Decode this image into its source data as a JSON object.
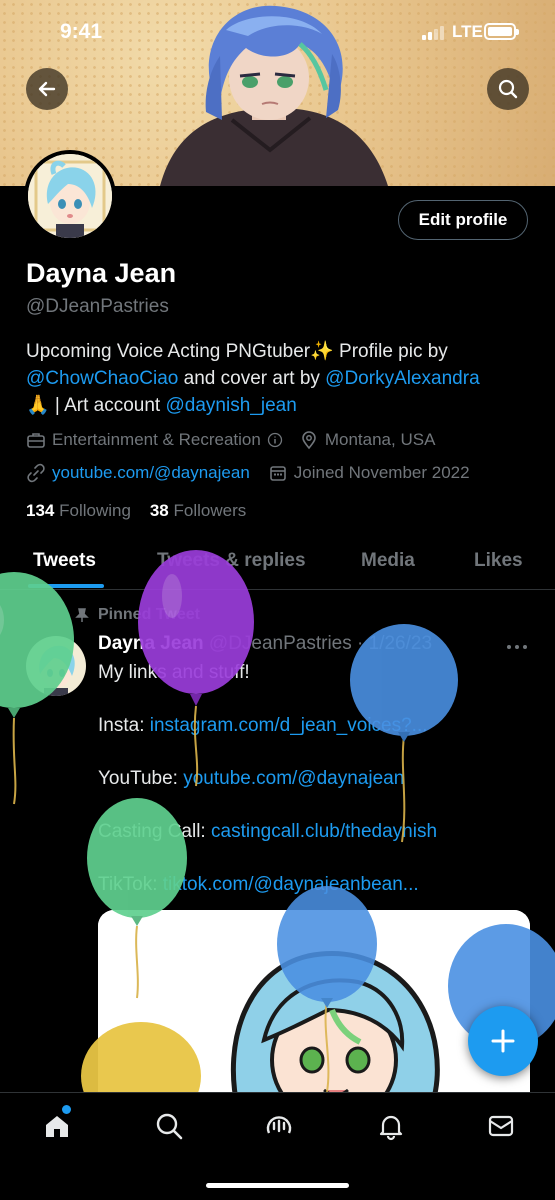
{
  "status_bar": {
    "time": "9:41",
    "network": "LTE"
  },
  "profile": {
    "name": "Dayna Jean",
    "handle": "@DJeanPastries",
    "edit_label": "Edit profile",
    "bio": {
      "part1": "Upcoming Voice Acting PNGtuber✨  Profile pic by ",
      "mention1": "@ChowChaoCiao",
      "part2": " and cover art by ",
      "mention2": "@DorkyAlexandra",
      "part3": "🙏 | Art account ",
      "mention3": "@daynish_jean"
    },
    "category": "Entertainment & Recreation",
    "location": "Montana, USA",
    "website": "youtube.com/@daynajean",
    "joined": "Joined November 2022",
    "following_count": "134",
    "following_label": "Following",
    "followers_count": "38",
    "followers_label": "Followers"
  },
  "tabs": [
    {
      "label": "Tweets",
      "active": true
    },
    {
      "label": "Tweets & replies",
      "active": false
    },
    {
      "label": "Media",
      "active": false
    },
    {
      "label": "Likes",
      "active": false
    }
  ],
  "tweet": {
    "pinned_label": "Pinned Tweet",
    "author": "Dayna Jean",
    "handle": "@DJeanPastries",
    "date": "· 1/26/23",
    "text": "My links and stuff!",
    "insta_label": "Insta: ",
    "insta_link": "instagram.com/d_jean_voices?...",
    "youtube_label": "YouTube: ",
    "youtube_link": "youtube.com/@daynajean",
    "casting_label": "Casting Call: ",
    "casting_link": "castingcall.club/thedaynish",
    "tiktok_label": "TikTok: ",
    "tiktok_link": "tiktok.com/@daynajeanbean..."
  },
  "icons": {
    "back": "back-arrow-icon",
    "search": "search-icon",
    "compose": "plus-icon",
    "nav": [
      "home-icon",
      "search-icon",
      "spaces-icon",
      "notifications-icon",
      "messages-icon"
    ]
  },
  "colors": {
    "accent": "#1d9bf0",
    "background": "#000000",
    "muted": "#71767b",
    "balloon_green": "#5fd08f",
    "balloon_purple": "#9b3ddb",
    "balloon_blue": "#4a90e2",
    "balloon_yellow": "#e8c544"
  }
}
